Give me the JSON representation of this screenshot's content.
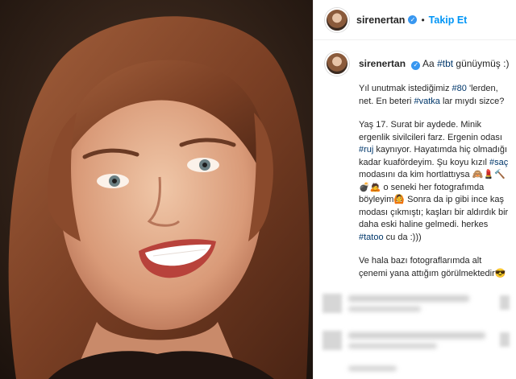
{
  "post": {
    "username": "sirenertan",
    "follow_label": "Takip Et",
    "header_separator": "•",
    "verified_mark": "✓"
  },
  "caption": {
    "username": "sirenertan",
    "first_line_prefix": "Aa ",
    "first_line_tag": "#tbt",
    "first_line_suffix": " günüymüş :)",
    "para1_a": "Yıl unutmak istediğimiz ",
    "para1_tag1": "#80",
    "para1_b": " 'lerden, net. En beteri ",
    "para1_tag2": "#vatka",
    "para1_c": " lar mıydı sizce?",
    "para2_a": "Yaş 17. Surat bir aydede. Minik ergenlik sivilcileri farz. Ergenin odası ",
    "para2_tag1": "#ruj",
    "para2_b": " kaynıyor. Hayatımda hiç olmadığı kadar kuaförde­yim. Şu koyu kızıl ",
    "para2_tag2": "#saç",
    "para2_c": " modasını da kim hortlattıysa 🙈💄🔨 💣🙇 o seneki her fotografımda böyleyim🙆 Sonra da ip gibi ince kaş modası çıkmıştı; kaşları bir aldırdık bir daha eski haline gelmedi. herkes ",
    "para2_tag3": "#tatoo",
    "para2_d": " cu da :)))",
    "para3": "Ve hala bazı fotograflarımda alt çenemi yana attığım görülmektedir😎"
  },
  "colors": {
    "link": "#0095f6",
    "hashtag": "#00376b",
    "text": "#262626"
  }
}
